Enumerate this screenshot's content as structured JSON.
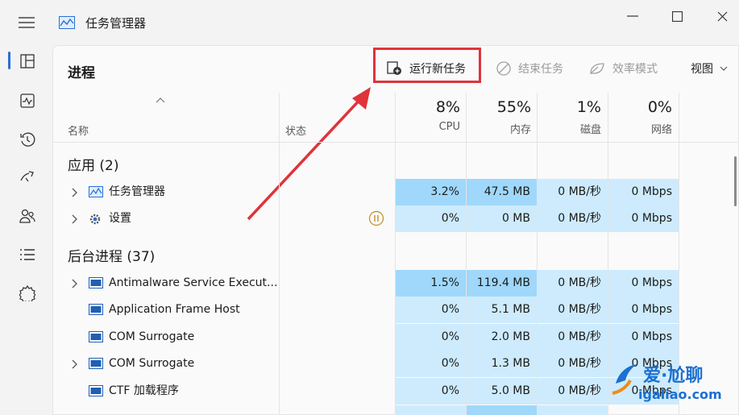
{
  "window": {
    "title": "任务管理器"
  },
  "page": {
    "title": "进程"
  },
  "toolbar": {
    "run_new_task": "运行新任务",
    "end_task": "结束任务",
    "efficiency_mode": "效率模式",
    "view": "视图"
  },
  "columns": {
    "name": "名称",
    "status": "状态",
    "cpu": {
      "pct": "8%",
      "label": "CPU"
    },
    "memory": {
      "pct": "55%",
      "label": "内存"
    },
    "disk": {
      "pct": "1%",
      "label": "磁盘"
    },
    "network": {
      "pct": "0%",
      "label": "网络"
    }
  },
  "groups": {
    "apps": "应用 (2)",
    "background": "后台进程 (37)"
  },
  "rows": [
    {
      "name": "任务管理器",
      "cpu": "3.2%",
      "mem": "47.5 MB",
      "disk": "0 MB/秒",
      "net": "0 Mbps"
    },
    {
      "name": "设置",
      "cpu": "0%",
      "mem": "0 MB",
      "disk": "0 MB/秒",
      "net": "0 Mbps"
    },
    {
      "name": "Antimalware Service Execut...",
      "cpu": "1.5%",
      "mem": "119.4 MB",
      "disk": "0 MB/秒",
      "net": "0 Mbps"
    },
    {
      "name": "Application Frame Host",
      "cpu": "0%",
      "mem": "5.1 MB",
      "disk": "0 MB/秒",
      "net": "0 Mbps"
    },
    {
      "name": "COM Surrogate",
      "cpu": "0%",
      "mem": "2.0 MB",
      "disk": "0 MB/秒",
      "net": "0 Mbps"
    },
    {
      "name": "COM Surrogate",
      "cpu": "0%",
      "mem": "1.3 MB",
      "disk": "0 MB/秒",
      "net": "0 Mbps"
    },
    {
      "name": "CTF 加载程序",
      "cpu": "0%",
      "mem": "5.0 MB",
      "disk": "0 MB/秒",
      "net": "0 Mbps"
    }
  ],
  "watermark": {
    "brand": "爱·尬聊",
    "domain": "igaliao.com"
  },
  "colors": {
    "accent": "#2a6fd6",
    "highlight": "#e0333a",
    "heat_strong": "#9fd8fb",
    "heat_light": "#cdebfd"
  }
}
